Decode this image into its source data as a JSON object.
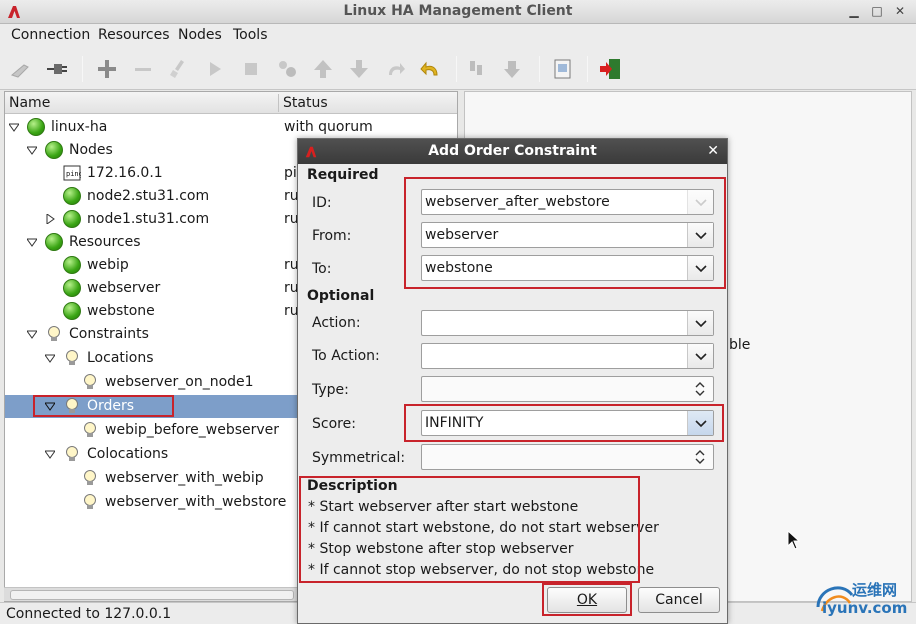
{
  "window": {
    "title": "Linux HA Management Client"
  },
  "menu": [
    "Connection",
    "Resources",
    "Nodes",
    "Tools"
  ],
  "tree": {
    "columns": {
      "name": "Name",
      "status": "Status"
    },
    "rows": [
      {
        "label": "linux-ha",
        "status": "with quorum"
      },
      {
        "label": "Nodes",
        "status": ""
      },
      {
        "label": "172.16.0.1",
        "status": "pi"
      },
      {
        "label": "node2.stu31.com",
        "status": "ru"
      },
      {
        "label": "node1.stu31.com",
        "status": "ru"
      },
      {
        "label": "Resources",
        "status": ""
      },
      {
        "label": "webip",
        "status": "ru"
      },
      {
        "label": "webserver",
        "status": "ru"
      },
      {
        "label": "webstone",
        "status": "ru"
      },
      {
        "label": "Constraints",
        "status": ""
      },
      {
        "label": "Locations",
        "status": ""
      },
      {
        "label": "webserver_on_node1",
        "status": ""
      },
      {
        "label": "Orders",
        "status": ""
      },
      {
        "label": "webip_before_webserver",
        "status": ""
      },
      {
        "label": "Colocations",
        "status": ""
      },
      {
        "label": "webserver_with_webip",
        "status": ""
      },
      {
        "label": "webserver_with_webstore",
        "status": ""
      }
    ]
  },
  "right_panel": {
    "text": "ble"
  },
  "status_bar": {
    "text": "Connected to 127.0.0.1"
  },
  "dialog": {
    "title": "Add Order Constraint",
    "required_title": "Required",
    "optional_title": "Optional",
    "description_title": "Description",
    "fields": {
      "id": {
        "label": "ID:",
        "value": "webserver_after_webstore"
      },
      "from": {
        "label": "From:",
        "value": "webserver"
      },
      "to": {
        "label": "To:",
        "value": "webstone"
      },
      "action": {
        "label": "Action:",
        "value": ""
      },
      "to_action": {
        "label": "To Action:",
        "value": ""
      },
      "type": {
        "label": "Type:",
        "value": ""
      },
      "score": {
        "label": "Score:",
        "value": "INFINITY"
      },
      "symmetrical": {
        "label": "Symmetrical:",
        "value": ""
      }
    },
    "description": [
      "* Start webserver after start webstone",
      "* If cannot start webstone, do not start webserver",
      "* Stop webstone after stop webserver",
      "* If cannot stop webserver, do not stop webstone"
    ],
    "ok_label": "OK",
    "cancel_label": "Cancel"
  },
  "watermark": {
    "cn": "运维网",
    "url": "iyunv.com"
  },
  "colors": {
    "selection": "#7d9ec9",
    "annotation_red": "#c8232b",
    "dialog_title": "#3a3a3a"
  }
}
